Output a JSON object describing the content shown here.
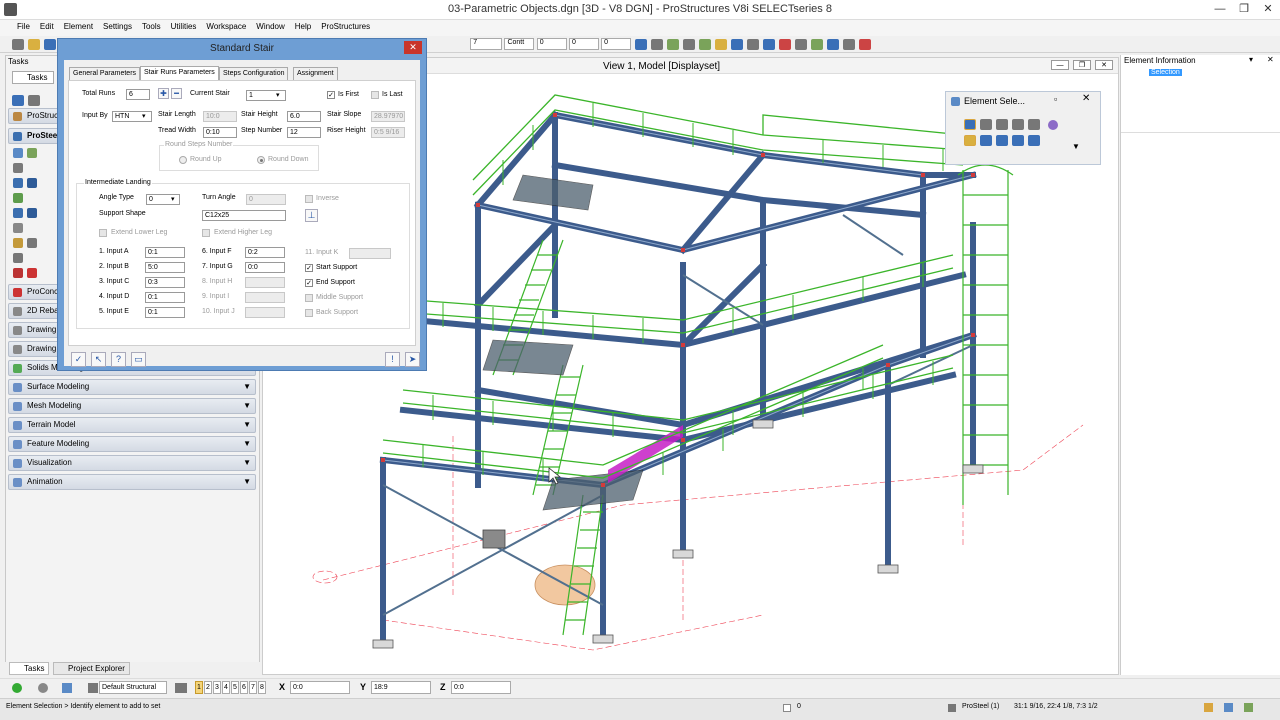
{
  "window": {
    "title": "03-Parametric Objects.dgn [3D - V8 DGN] - ProStructures V8i SELECTseries 8"
  },
  "menu": [
    "File",
    "Edit",
    "Element",
    "Settings",
    "Tools",
    "Utilities",
    "Workspace",
    "Window",
    "Help",
    "ProStructures"
  ],
  "toolbar": {
    "level_value": "7",
    "color_value": "0",
    "weight_value": "0",
    "style_value": "0",
    "linestyle_label": "Contt"
  },
  "tasks": {
    "title": "Tasks",
    "tab_label": "Tasks",
    "group1": "ProStructures",
    "group2": "ProSteel",
    "collapsed": [
      "ProConcrete",
      "2D Rebar",
      "Drawing",
      "Drawing",
      "Solids Modeling"
    ],
    "sections": [
      "Surface Modeling",
      "Mesh Modeling",
      "Terrain Model",
      "Feature Modeling",
      "Visualization",
      "Animation"
    ],
    "bottom_tabs": [
      "Tasks",
      "Project Explorer"
    ]
  },
  "dialog": {
    "title": "Standard Stair",
    "tabs": [
      "General Parameters",
      "Stair Runs Parameters",
      "Steps Configuration",
      "Assignment"
    ],
    "total_runs_label": "Total Runs",
    "total_runs": "6",
    "current_stair_label": "Current Stair",
    "current_stair": "1",
    "is_first": "Is First",
    "is_last": "Is Last",
    "input_by_label": "Input By",
    "input_by": "HTN",
    "stair_length_label": "Stair Length",
    "stair_length": "10:0",
    "stair_height_label": "Stair Height",
    "stair_height": "6.0",
    "stair_slope_label": "Stair Slope",
    "stair_slope": "28.97970",
    "tread_width_label": "Tread Width",
    "tread_width": "0:10",
    "step_number_label": "Step Number",
    "step_number": "12",
    "riser_height_label": "Riser Height",
    "riser_height": "0:5 9/16",
    "round_steps_label": "Round Steps Number",
    "round_up": "Round Up",
    "round_down": "Round Down",
    "landing_group": "Intermediate Landing",
    "angle_type_label": "Angle Type",
    "angle_type": "0",
    "turn_angle_label": "Turn Angle",
    "turn_angle": "0",
    "inverse_label": "Inverse",
    "support_shape_label": "Support Shape",
    "support_shape": "C12x25",
    "extend_lower": "Extend Lower Leg",
    "extend_higher": "Extend Higher Leg",
    "inputs_left": [
      {
        "label": "1. Input A",
        "value": "0:1"
      },
      {
        "label": "2. Input B",
        "value": "5:0"
      },
      {
        "label": "3. Input C",
        "value": "0:3"
      },
      {
        "label": "4. Input D",
        "value": "0:1"
      },
      {
        "label": "5. Input E",
        "value": "0:1"
      }
    ],
    "inputs_mid": [
      {
        "label": "6. Input F",
        "value": "0:2"
      },
      {
        "label": "7. Input G",
        "value": "0:0"
      },
      {
        "label": "8. Input H",
        "value": ""
      },
      {
        "label": "9. Input I",
        "value": ""
      },
      {
        "label": "10. Input J",
        "value": ""
      }
    ],
    "input_k_label": "11. Input K",
    "supports": [
      {
        "label": "Start Support",
        "checked": true
      },
      {
        "label": "End Support",
        "checked": true
      },
      {
        "label": "Middle Support",
        "checked": false
      },
      {
        "label": "Back Support",
        "checked": false
      }
    ]
  },
  "view": {
    "title": "View 1, Model [Displayset]"
  },
  "element_selection": {
    "title": "Element Sele..."
  },
  "element_info": {
    "title": "Element Information",
    "item": "Selection"
  },
  "keyin": {
    "x_label": "X",
    "x_value": "0:0",
    "y_label": "Y",
    "y_value": "18:9",
    "z_label": "Z",
    "z_value": "0:0",
    "model_combo": "Default Structural",
    "view_nums": [
      "1",
      "2",
      "3",
      "4",
      "5",
      "6",
      "7",
      "8"
    ]
  },
  "status": {
    "prompt": "Element Selection > Identify element to add to set",
    "zero": "0",
    "product": "ProSteel (1)",
    "coords": "31:1 9/16, 22:4 1/8, 7:3 1/2"
  },
  "colors": {
    "steel": "#3c5b8c",
    "rail": "#3bb52a",
    "highlight": "#c61ec6",
    "dialog_frame": "#6e9ed4"
  }
}
